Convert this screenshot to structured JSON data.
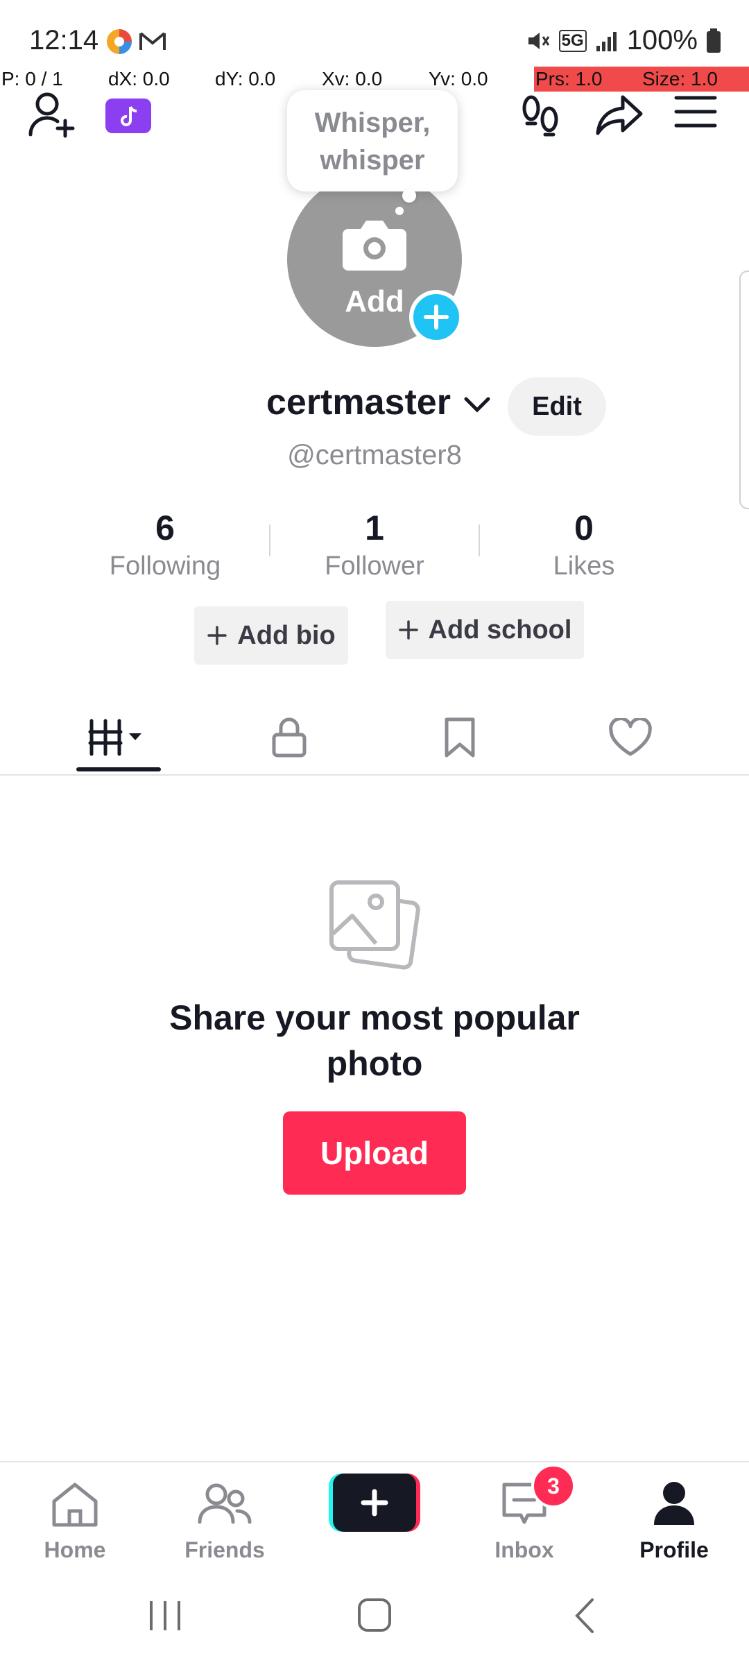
{
  "status_bar": {
    "time": "12:14",
    "battery": "100%",
    "network": "5G"
  },
  "pointer_overlay": {
    "p": "P: 0 / 1",
    "dx": "dX: 0.0",
    "dy": "dY: 0.0",
    "xv": "Xv: 0.0",
    "yv": "Yv: 0.0",
    "prs": "Prs: 1.0",
    "size": "Size: 1.0"
  },
  "tooltip": {
    "line1": "Whisper,",
    "line2": "whisper"
  },
  "avatar": {
    "add_label": "Add"
  },
  "profile": {
    "username": "certmaster",
    "handle": "@certmaster8",
    "edit_label": "Edit"
  },
  "stats": [
    {
      "value": "6",
      "label": "Following"
    },
    {
      "value": "1",
      "label": "Follower"
    },
    {
      "value": "0",
      "label": "Likes"
    }
  ],
  "bio_buttons": {
    "add_bio": "Add bio",
    "add_school": "Add school"
  },
  "empty_state": {
    "title_line1": "Share your most popular",
    "title_line2": "photo",
    "upload_label": "Upload"
  },
  "bottom_nav": {
    "home": "Home",
    "friends": "Friends",
    "inbox": "Inbox",
    "profile": "Profile",
    "inbox_badge": "3"
  },
  "colors": {
    "accent": "#fe2c55",
    "cyan": "#20c4f4",
    "text": "#161823",
    "muted": "#8a8b91"
  }
}
